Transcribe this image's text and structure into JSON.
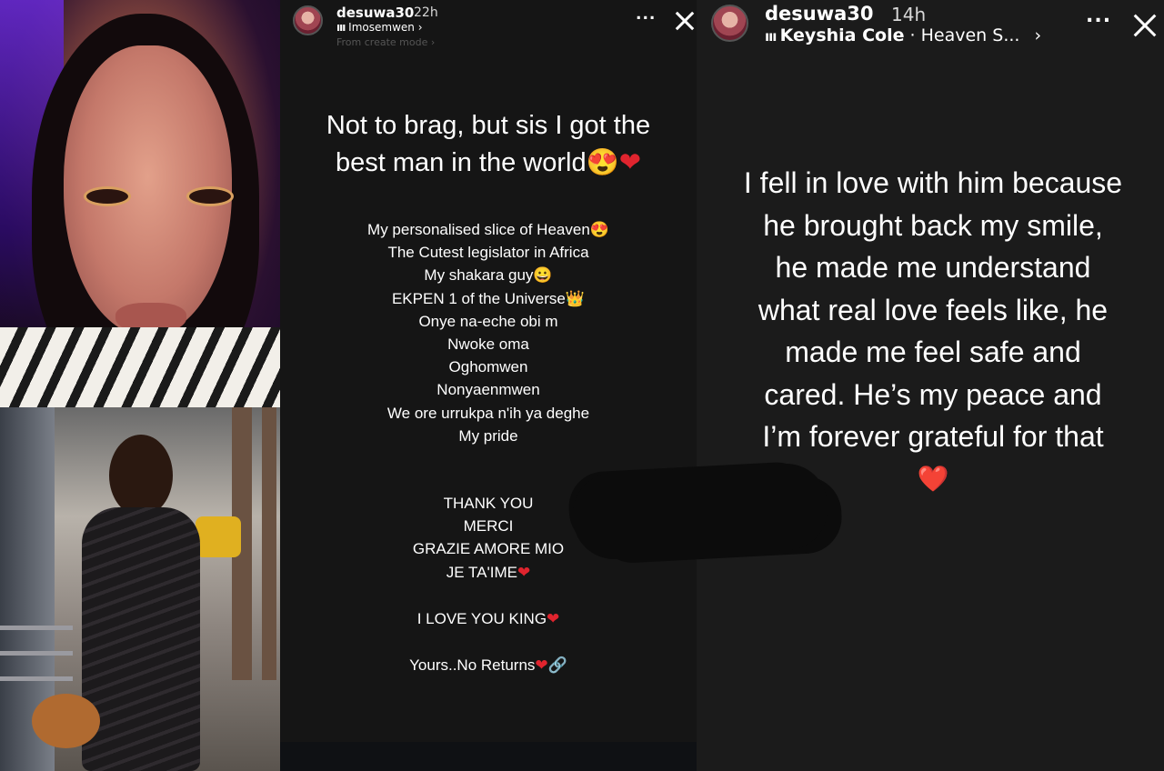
{
  "colors": {
    "heart": "#e0242e",
    "mid_bg": "#151515",
    "right_bg": "#1b1b1b"
  },
  "story_left": {
    "username": "desuwa30",
    "time": "22h",
    "music_label": "Imosemwen",
    "chevron": "›",
    "subnote": "From create mode ›",
    "more": "...",
    "headline_line1": "Not to brag, but sis I got the",
    "headline_line2": "best man in the world",
    "headline_emoji": "😍",
    "heart": "❤",
    "lines": [
      "My personalised slice of Heaven😍",
      "The Cutest legislator in Africa",
      "My shakara guy😀",
      "EKPEN 1 of the Universe👑",
      "Onye na-eche obi m",
      "Nwoke oma",
      "Oghomwen",
      "Nonyaenmwen",
      "We ore urrukpa n'ih ya deghe",
      "My pride"
    ],
    "thanks": [
      "THANK YOU",
      "MERCI",
      "GRAZIE AMORE MIO"
    ],
    "jetaime": "JE TA'IME",
    "ilove": "I LOVE YOU KING",
    "yours": "Yours..No Returns",
    "link_emoji": "🔗"
  },
  "story_right": {
    "username": "desuwa30",
    "time": "14h",
    "music_artist": "Keyshia Cole",
    "music_sep": " · ",
    "music_track": "Heaven S...",
    "chevron": "›",
    "more": "...",
    "text_lines": [
      "I fell in love with him because",
      "he brought back my smile,",
      "he made me understand",
      "what real love feels like, he",
      "made me feel safe and",
      "cared. He’s my peace and",
      "I’m forever grateful for that"
    ],
    "heart": "❤️"
  }
}
